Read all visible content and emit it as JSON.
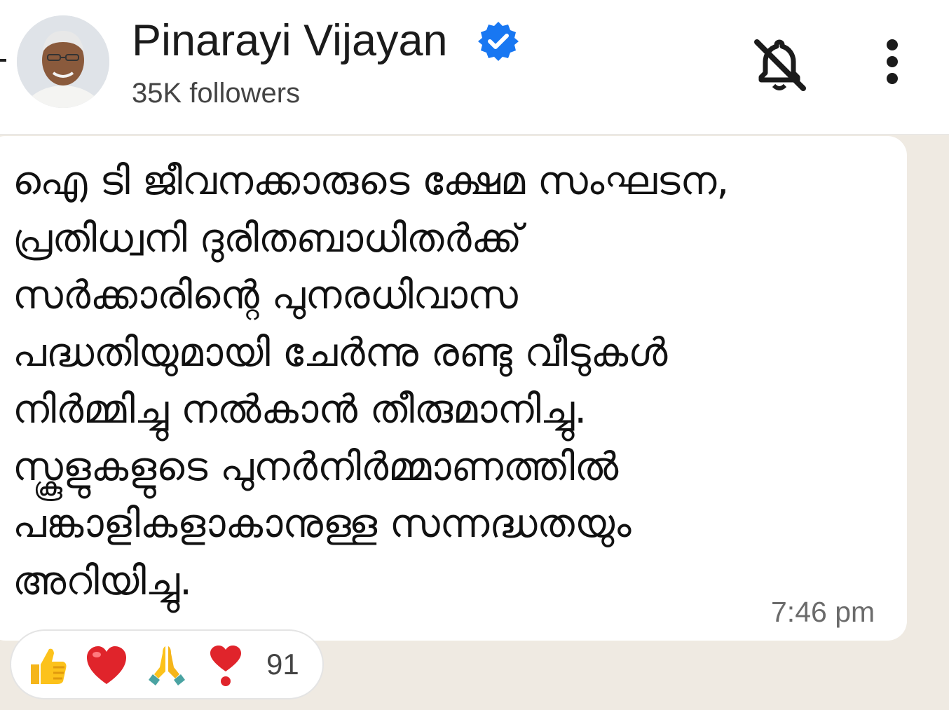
{
  "header": {
    "channel_name": "Pinarayi Vijayan",
    "followers": "35K followers",
    "verified_color": "#1877f2",
    "icons": [
      "back-arrow-icon",
      "verified-badge-icon",
      "mute-bell-icon",
      "more-options-icon"
    ]
  },
  "message": {
    "text": "ഐ ടി ജീവനക്കാരുടെ ക്ഷേമ സംഘടന,\nപ്രതിധ്വനി ദുരിതബാധിതർക്ക്\nസർക്കാരിന്റെ പുനരധിവാസ\nപദ്ധതിയുമായി ചേർന്നു രണ്ടു വീടുകൾ\nനിർമ്മിച്ചു നൽകാൻ തീരുമാനിച്ചു.\nസ്കൂളുകളുടെ പുനർനിർമ്മാണത്തിൽ\nപങ്കാളികളാകാനുള്ള സന്നദ്ധതയും\nഅറിയിച്ചു.",
    "time": "7:46 pm"
  },
  "reactions": {
    "emojis": [
      "thumbs-up",
      "red-heart",
      "folded-hands",
      "heart-exclamation"
    ],
    "count": "91"
  },
  "colors": {
    "background": "#efeae2",
    "bubble": "#ffffff",
    "text": "#111111"
  }
}
